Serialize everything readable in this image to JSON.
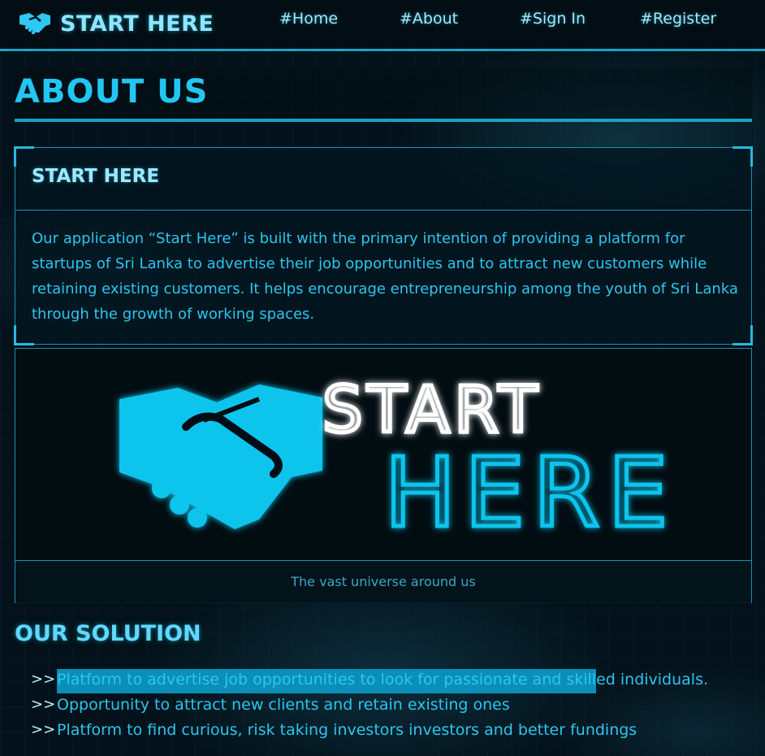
{
  "nav": {
    "brand": "START HERE",
    "links": [
      "#Home",
      "#About",
      "#Sign In",
      "#Register"
    ]
  },
  "about": {
    "heading": "ABOUT US",
    "card_title": "START HERE",
    "card_body": "Our application “Start Here” is built with the primary intention of providing a platform for startups of Sri Lanka to advertise their job opportunities and to attract new customers while retaining existing customers. It helps encourage entrepreneurship among the youth of Sri Lanka through the growth of working spaces."
  },
  "image": {
    "logo_word_1": "START",
    "logo_word_2": "HERE",
    "caption": "The vast universe around us"
  },
  "solution": {
    "heading": "OUR SOLUTION",
    "bullet": ">>",
    "items": [
      "Platform to advertise job opportunities to look for passionate and skilled individuals.",
      "Opportunity to attract new clients and retain existing ones",
      "Platform to find curious, risk taking investors investors and better fundings"
    ]
  },
  "colors": {
    "accent": "#1aa2c8",
    "text": "#23c4ee",
    "highlight": "#0b8fb8",
    "logo_cyan": "#10c4ec"
  }
}
